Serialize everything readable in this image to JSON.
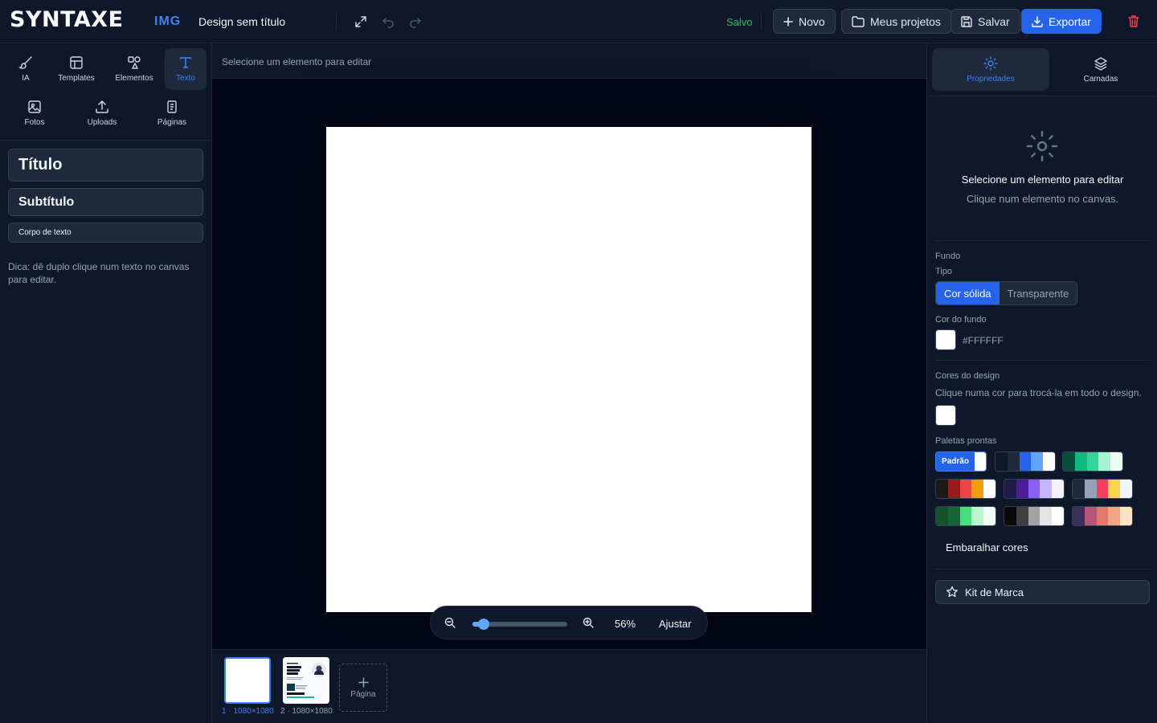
{
  "header": {
    "logo": "SYNTAXE",
    "logo_suffix": "IMG",
    "doc_title": "Design sem título",
    "save_status": "Salvo",
    "buttons": {
      "new": "Novo",
      "projects": "Meus projetos",
      "save": "Salvar",
      "export": "Exportar"
    }
  },
  "left_panel": {
    "tools": [
      {
        "label": "IA",
        "icon": "brush-icon"
      },
      {
        "label": "Templates",
        "icon": "template-icon"
      },
      {
        "label": "Elementos",
        "icon": "shapes-icon"
      },
      {
        "label": "Texto",
        "icon": "text-icon",
        "active": true
      },
      {
        "label": "Fotos",
        "icon": "image-icon"
      },
      {
        "label": "Uploads",
        "icon": "upload-icon"
      },
      {
        "label": "Páginas",
        "icon": "pages-icon"
      }
    ],
    "text_styles": {
      "title": "Título",
      "subtitle": "Subtítulo",
      "body": "Corpo de texto"
    },
    "tip": "Dica: dê duplo clique num texto no canvas para editar."
  },
  "canvas_area": {
    "hint": "Selecione um elemento para editar",
    "canvas_color": "#FFFFFF",
    "zoom": {
      "percent_label": "56%",
      "fit_label": "Ajustar",
      "level": 0.12
    }
  },
  "pages": {
    "items": [
      {
        "label": "1 · 1080×1080",
        "selected": true
      },
      {
        "label": "2 · 1080×1080",
        "selected": false
      }
    ],
    "add_label": "Página"
  },
  "right_panel": {
    "tabs": {
      "properties": "Propriedades",
      "layers": "Camadas"
    },
    "empty_title": "Selecione um elemento para editar",
    "empty_sub": "Clique num elemento no canvas.",
    "background": {
      "section": "Fundo",
      "type_label": "Tipo",
      "solid": "Cor sólida",
      "transparent": "Transparente",
      "color_label": "Cor do fundo",
      "color_value": "#FFFFFF"
    },
    "design_colors": {
      "section": "Cores do design",
      "hint": "Clique numa cor para trocá-la em todo o design."
    },
    "palettes": {
      "section": "Paletas prontas",
      "default_label": "Padrão",
      "items": [
        [
          "#0f172a",
          "#1e293b",
          "#2563eb",
          "#60a5fa",
          "#f8fafc"
        ],
        [
          "#064e3b",
          "#10b981",
          "#34d399",
          "#a7f3d0",
          "#ecfdf5"
        ],
        [
          "#1c1917",
          "#991b1b",
          "#ef4444",
          "#f59e0b",
          "#ffffff"
        ],
        [
          "#1e1b4b",
          "#4c1d95",
          "#8b5cf6",
          "#c4b5fd",
          "#f5f3ff"
        ],
        [
          "#1e293b",
          "#94a3b8",
          "#f43f5e",
          "#fcd34d",
          "#f1f5f9"
        ],
        [
          "#14532d",
          "#166534",
          "#4ade80",
          "#bbf7d0",
          "#f0fdf4"
        ],
        [
          "#0a0a0a",
          "#404040",
          "#a3a3a3",
          "#e5e5e5",
          "#ffffff"
        ],
        [
          "#3b2f5c",
          "#b4577a",
          "#e07a6a",
          "#f4a582",
          "#fde2c4"
        ]
      ]
    },
    "shuffle": "Embaralhar cores",
    "brand_kit": "Kit de Marca"
  },
  "colors": {
    "accent": "#2563eb",
    "saved_green": "#22c55e",
    "danger": "#ef4444"
  }
}
